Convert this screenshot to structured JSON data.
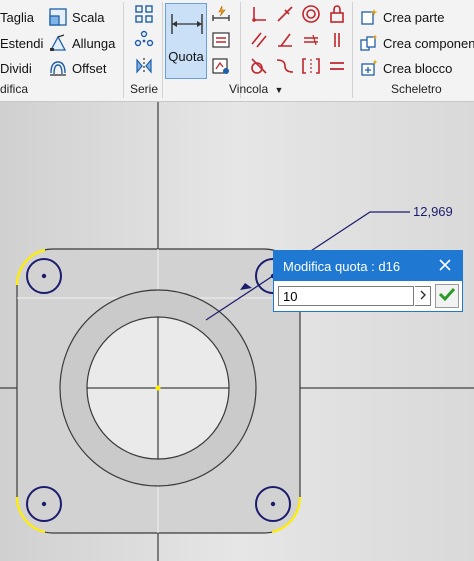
{
  "ribbon": {
    "modify_panel": {
      "label": "difica",
      "items": [
        {
          "label": "Taglia",
          "icon": "trim-icon"
        },
        {
          "label": "Estendi",
          "icon": "extend-icon"
        },
        {
          "label": "Dividi",
          "icon": "split-icon"
        },
        {
          "label": "Scala",
          "icon": "scale-icon"
        },
        {
          "label": "Allunga",
          "icon": "stretch-icon"
        },
        {
          "label": "Offset",
          "icon": "offset-icon"
        }
      ]
    },
    "pattern_panel": {
      "label": "Serie"
    },
    "constraint_panel": {
      "label": "Vincola",
      "dimension_button": "Quota"
    },
    "skeleton_panel": {
      "label": "Scheletro",
      "items": [
        {
          "label": "Crea parte",
          "icon": "make-part-icon"
        },
        {
          "label": "Crea componen",
          "icon": "make-components-icon"
        },
        {
          "label": "Crea blocco",
          "icon": "create-block-icon"
        }
      ]
    }
  },
  "colors": {
    "accent_blue": "#1f78d1",
    "sketch_navy": "#1c1c6e",
    "highlight_yellow": "#ffee00",
    "part_fill": "#d2d2d2",
    "constraint_red": "#c0262c"
  },
  "canvas": {
    "dimension_value": "12,969"
  },
  "dialog": {
    "title": "Modifica quota : d16",
    "input_value": "10"
  }
}
